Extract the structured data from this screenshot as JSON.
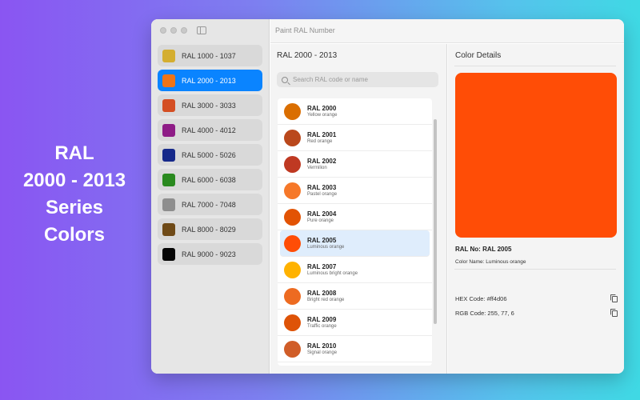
{
  "promo": {
    "line1": "RAL",
    "line2": "2000 - 2013",
    "line3": "Series",
    "line4": "Colors"
  },
  "window": {
    "title": "Paint RAL Number"
  },
  "sidebar": {
    "items": [
      {
        "label": "RAL 1000 - 1037",
        "color": "#d4ae30"
      },
      {
        "label": "RAL 2000 - 2013",
        "color": "#ee7418"
      },
      {
        "label": "RAL 3000 - 3033",
        "color": "#d44e23"
      },
      {
        "label": "RAL 4000 - 4012",
        "color": "#8e1c86"
      },
      {
        "label": "RAL 5000 - 5026",
        "color": "#16298a"
      },
      {
        "label": "RAL 6000 - 6038",
        "color": "#2a8a1f"
      },
      {
        "label": "RAL 7000 - 7048",
        "color": "#8e8e8e"
      },
      {
        "label": "RAL 8000 - 8029",
        "color": "#6f4a17"
      },
      {
        "label": "RAL 9000 - 9023",
        "color": "#050505"
      }
    ],
    "selected_index": 1
  },
  "middle": {
    "heading": "RAL 2000 - 2013",
    "search_placeholder": "Search RAL code or name",
    "colors": [
      {
        "code": "RAL 2000",
        "name": "Yellow orange",
        "color": "#da6e00"
      },
      {
        "code": "RAL 2001",
        "name": "Red orange",
        "color": "#ba481c"
      },
      {
        "code": "RAL 2002",
        "name": "Vermilion",
        "color": "#bf3922"
      },
      {
        "code": "RAL 2003",
        "name": "Pastel orange",
        "color": "#f67829"
      },
      {
        "code": "RAL 2004",
        "name": "Pure orange",
        "color": "#e25304"
      },
      {
        "code": "RAL 2005",
        "name": "Luminous orange",
        "color": "#ff4d06"
      },
      {
        "code": "RAL 2007",
        "name": "Luminous bright orange",
        "color": "#ffb200"
      },
      {
        "code": "RAL 2008",
        "name": "Bright red orange",
        "color": "#ed6b21"
      },
      {
        "code": "RAL 2009",
        "name": "Traffic orange",
        "color": "#de5307"
      },
      {
        "code": "RAL 2010",
        "name": "Signal orange",
        "color": "#d05d28"
      }
    ],
    "selected_index": 5
  },
  "details": {
    "heading": "Color Details",
    "swatch_color": "#ff4d06",
    "ral_no": "RAL No: RAL 2005",
    "color_name": "Color Name: Luminous orange",
    "hex": "HEX Code: #ff4d06",
    "rgb": "RGB Code: 255, 77, 6"
  }
}
